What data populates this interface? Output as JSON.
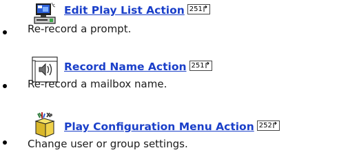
{
  "actions": [
    {
      "icon": "play-list-computer-icon",
      "label": "Edit Play List Action",
      "page": "251",
      "description": "Re-record a prompt."
    },
    {
      "icon": "record-speaker-icon",
      "label": "Record Name Action",
      "page": "251",
      "description": "Re-record a mailbox name."
    },
    {
      "icon": "configuration-box-icon",
      "label": "Play Configuration Menu Action",
      "page": "252",
      "description": "Change user or group settings."
    }
  ],
  "colors": {
    "link": "#1a3fc9",
    "text": "#1b1b1b"
  }
}
